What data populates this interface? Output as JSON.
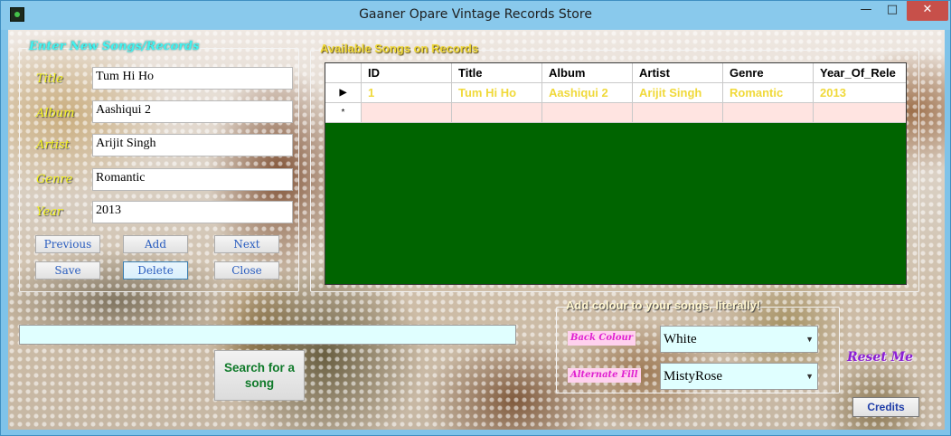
{
  "window": {
    "title": "Gaaner Opare Vintage Records Store",
    "minimize": "—",
    "maximize": "□",
    "close": "✕"
  },
  "entry": {
    "group_title": "Enter New Songs/Records",
    "fields": {
      "title": {
        "label": "Title",
        "value": "Tum Hi Ho"
      },
      "album": {
        "label": "Album",
        "value": "Aashiqui 2"
      },
      "artist": {
        "label": "Artist",
        "value": "Arijit Singh"
      },
      "genre": {
        "label": "Genre",
        "value": "Romantic"
      },
      "year": {
        "label": "Year",
        "value": "2013"
      }
    },
    "buttons": {
      "previous": "Previous",
      "add": "Add",
      "next": "Next",
      "save": "Save",
      "delete": "Delete",
      "close": "Close"
    }
  },
  "songs": {
    "group_title": "Available Songs on Records",
    "columns": [
      "ID",
      "Title",
      "Album",
      "Artist",
      "Genre",
      "Year_Of_Rele"
    ],
    "rows": [
      [
        "1",
        "Tum Hi Ho",
        "Aashiqui 2",
        "Arijit Singh",
        "Romantic",
        "2013"
      ]
    ],
    "current_row_marker": "▶",
    "new_row_marker": "*",
    "colors": {
      "background": "#006400",
      "text": "#f0d93a",
      "alternate": "#ffe4e1"
    }
  },
  "search": {
    "value": "",
    "button": "Search for a song"
  },
  "colour": {
    "group_title": "Add colour to your songs, literally!",
    "back_label": "Back Colour",
    "back_value": "White",
    "alt_label": "Alternate Fill",
    "alt_value": "MistyRose"
  },
  "reset_label": "Reset Me",
  "credits_label": "Credits"
}
